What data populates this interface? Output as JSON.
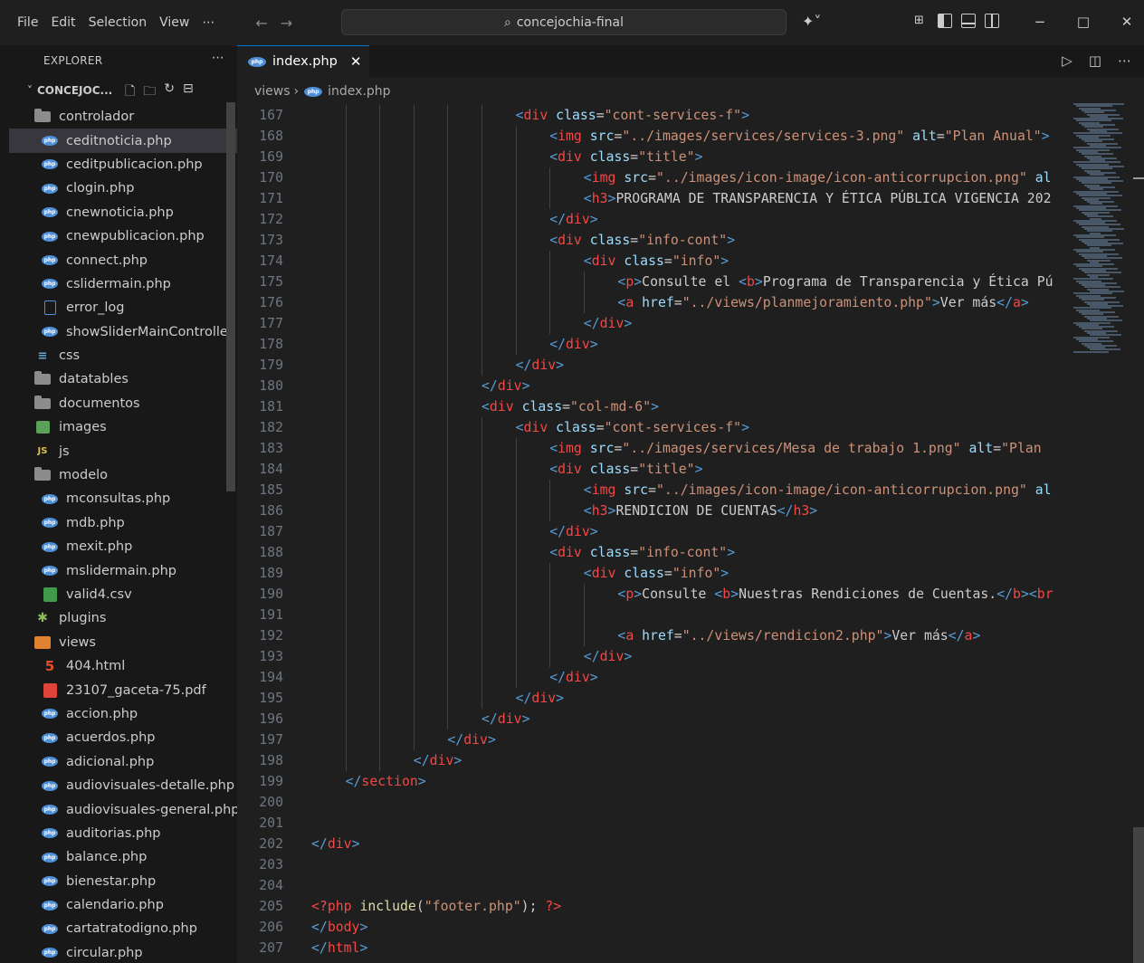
{
  "menu": [
    "File",
    "Edit",
    "Selection",
    "View",
    "⋯"
  ],
  "search": {
    "text": "concejochia-final"
  },
  "window": {
    "minimize": "−",
    "maximize": "□",
    "close": "✕"
  },
  "sidebar": {
    "title": "EXPLORER",
    "more": "⋯",
    "folder_name": "CONCEJOC...",
    "items": [
      {
        "label": "controlador",
        "icon": "folder-icon",
        "level": 1
      },
      {
        "label": "ceditnoticia.php",
        "icon": "php-icon",
        "level": 2,
        "active": true
      },
      {
        "label": "ceditpublicacion.php",
        "icon": "php-icon",
        "level": 2
      },
      {
        "label": "clogin.php",
        "icon": "php-icon",
        "level": 2
      },
      {
        "label": "cnewnoticia.php",
        "icon": "php-icon",
        "level": 2
      },
      {
        "label": "cnewpublicacion.php",
        "icon": "php-icon",
        "level": 2
      },
      {
        "label": "connect.php",
        "icon": "php-icon",
        "level": 2
      },
      {
        "label": "cslidermain.php",
        "icon": "php-icon",
        "level": 2
      },
      {
        "label": "error_log",
        "icon": "file-icon",
        "level": 2
      },
      {
        "label": "showSliderMainControlle...",
        "icon": "php-icon",
        "level": 2
      },
      {
        "label": "css",
        "icon": "css-folder-icon",
        "level": 1
      },
      {
        "label": "datatables",
        "icon": "folder-icon",
        "level": 1
      },
      {
        "label": "documentos",
        "icon": "folder-icon",
        "level": 1
      },
      {
        "label": "images",
        "icon": "images-folder-icon",
        "level": 1
      },
      {
        "label": "js",
        "icon": "js-folder-icon",
        "level": 1
      },
      {
        "label": "modelo",
        "icon": "folder-icon",
        "level": 1
      },
      {
        "label": "mconsultas.php",
        "icon": "php-icon",
        "level": 2
      },
      {
        "label": "mdb.php",
        "icon": "php-icon",
        "level": 2
      },
      {
        "label": "mexit.php",
        "icon": "php-icon",
        "level": 2
      },
      {
        "label": "mslidermain.php",
        "icon": "php-icon",
        "level": 2
      },
      {
        "label": "valid4.csv",
        "icon": "csv-icon",
        "level": 2
      },
      {
        "label": "plugins",
        "icon": "plugins-folder-icon",
        "level": 1
      },
      {
        "label": "views",
        "icon": "views-folder-icon",
        "level": 1
      },
      {
        "label": "404.html",
        "icon": "html-icon",
        "level": 2
      },
      {
        "label": "23107_gaceta-75.pdf",
        "icon": "pdf-icon",
        "level": 2
      },
      {
        "label": "accion.php",
        "icon": "php-icon",
        "level": 2
      },
      {
        "label": "acuerdos.php",
        "icon": "php-icon",
        "level": 2
      },
      {
        "label": "adicional.php",
        "icon": "php-icon",
        "level": 2
      },
      {
        "label": "audiovisuales-detalle.php",
        "icon": "php-icon",
        "level": 2
      },
      {
        "label": "audiovisuales-general.php",
        "icon": "php-icon",
        "level": 2
      },
      {
        "label": "auditorias.php",
        "icon": "php-icon",
        "level": 2
      },
      {
        "label": "balance.php",
        "icon": "php-icon",
        "level": 2
      },
      {
        "label": "bienestar.php",
        "icon": "php-icon",
        "level": 2
      },
      {
        "label": "calendario.php",
        "icon": "php-icon",
        "level": 2
      },
      {
        "label": "cartatratodigno.php",
        "icon": "php-icon",
        "level": 2
      },
      {
        "label": "circular.php",
        "icon": "php-icon",
        "level": 2
      }
    ]
  },
  "tab": {
    "label": "index.php",
    "close": "✕"
  },
  "breadcrumb": {
    "folder": "views",
    "sep": "›",
    "file": "index.php"
  },
  "editor": {
    "lines": [
      {
        "n": "167",
        "indent": 6,
        "tokens": [
          [
            "t",
            "<"
          ],
          [
            "tr",
            "div"
          ],
          [
            "an",
            " class"
          ],
          [
            "tg",
            "="
          ],
          [
            "av",
            "\"cont-services-f\""
          ],
          [
            "t",
            ">"
          ]
        ]
      },
      {
        "n": "168",
        "indent": 7,
        "tokens": [
          [
            "t",
            "<"
          ],
          [
            "tr",
            "img"
          ],
          [
            "an",
            " src"
          ],
          [
            "tg",
            "="
          ],
          [
            "av",
            "\"../images/services/services-3.png\""
          ],
          [
            "an",
            " alt"
          ],
          [
            "tg",
            "="
          ],
          [
            "av",
            "\"Plan Anual\""
          ],
          [
            "t",
            ">"
          ]
        ]
      },
      {
        "n": "169",
        "indent": 7,
        "tokens": [
          [
            "t",
            "<"
          ],
          [
            "tr",
            "div"
          ],
          [
            "an",
            " class"
          ],
          [
            "tg",
            "="
          ],
          [
            "av",
            "\"title\""
          ],
          [
            "t",
            ">"
          ]
        ]
      },
      {
        "n": "170",
        "indent": 8,
        "tokens": [
          [
            "t",
            "<"
          ],
          [
            "tr",
            "img"
          ],
          [
            "an",
            " src"
          ],
          [
            "tg",
            "="
          ],
          [
            "av",
            "\"../images/icon-image/icon-anticorrupcion.png\""
          ],
          [
            "an",
            " al"
          ]
        ]
      },
      {
        "n": "171",
        "indent": 8,
        "tokens": [
          [
            "t",
            "<"
          ],
          [
            "tr",
            "h3"
          ],
          [
            "t",
            ">"
          ],
          [
            "tg",
            "PROGRAMA DE TRANSPARENCIA Y ÉTICA PÚBLICA VIGENCIA 202"
          ]
        ]
      },
      {
        "n": "172",
        "indent": 7,
        "tokens": [
          [
            "t",
            "</"
          ],
          [
            "tr",
            "div"
          ],
          [
            "t",
            ">"
          ]
        ]
      },
      {
        "n": "173",
        "indent": 7,
        "tokens": [
          [
            "t",
            "<"
          ],
          [
            "tr",
            "div"
          ],
          [
            "an",
            " class"
          ],
          [
            "tg",
            "="
          ],
          [
            "av",
            "\"info-cont\""
          ],
          [
            "t",
            ">"
          ]
        ]
      },
      {
        "n": "174",
        "indent": 8,
        "tokens": [
          [
            "t",
            "<"
          ],
          [
            "tr",
            "div"
          ],
          [
            "an",
            " class"
          ],
          [
            "tg",
            "="
          ],
          [
            "av",
            "\"info\""
          ],
          [
            "t",
            ">"
          ]
        ]
      },
      {
        "n": "175",
        "indent": 9,
        "tokens": [
          [
            "t",
            "<"
          ],
          [
            "tr",
            "p"
          ],
          [
            "t",
            ">"
          ],
          [
            "tg",
            "Consulte el "
          ],
          [
            "t",
            "<"
          ],
          [
            "tr",
            "b"
          ],
          [
            "t",
            ">"
          ],
          [
            "tg",
            "Programa de Transparencia y Ética Pú"
          ]
        ]
      },
      {
        "n": "176",
        "indent": 9,
        "tokens": [
          [
            "t",
            "<"
          ],
          [
            "tr",
            "a"
          ],
          [
            "an",
            " href"
          ],
          [
            "tg",
            "="
          ],
          [
            "av",
            "\"../views/planmejoramiento.php\""
          ],
          [
            "t",
            ">"
          ],
          [
            "tg",
            "Ver más"
          ],
          [
            "t",
            "</"
          ],
          [
            "tr",
            "a"
          ],
          [
            "t",
            ">"
          ]
        ]
      },
      {
        "n": "177",
        "indent": 8,
        "tokens": [
          [
            "t",
            "</"
          ],
          [
            "tr",
            "div"
          ],
          [
            "t",
            ">"
          ]
        ]
      },
      {
        "n": "178",
        "indent": 7,
        "tokens": [
          [
            "t",
            "</"
          ],
          [
            "tr",
            "div"
          ],
          [
            "t",
            ">"
          ]
        ]
      },
      {
        "n": "179",
        "indent": 6,
        "tokens": [
          [
            "t",
            "</"
          ],
          [
            "tr",
            "div"
          ],
          [
            "t",
            ">"
          ]
        ]
      },
      {
        "n": "180",
        "indent": 5,
        "tokens": [
          [
            "t",
            "</"
          ],
          [
            "tr",
            "div"
          ],
          [
            "t",
            ">"
          ]
        ]
      },
      {
        "n": "181",
        "indent": 5,
        "tokens": [
          [
            "t",
            "<"
          ],
          [
            "tr",
            "div"
          ],
          [
            "an",
            " class"
          ],
          [
            "tg",
            "="
          ],
          [
            "av",
            "\"col-md-6\""
          ],
          [
            "t",
            ">"
          ]
        ]
      },
      {
        "n": "182",
        "indent": 6,
        "tokens": [
          [
            "t",
            "<"
          ],
          [
            "tr",
            "div"
          ],
          [
            "an",
            " class"
          ],
          [
            "tg",
            "="
          ],
          [
            "av",
            "\"cont-services-f\""
          ],
          [
            "t",
            ">"
          ]
        ]
      },
      {
        "n": "183",
        "indent": 7,
        "tokens": [
          [
            "t",
            "<"
          ],
          [
            "tr",
            "img"
          ],
          [
            "an",
            " src"
          ],
          [
            "tg",
            "="
          ],
          [
            "av",
            "\"../images/services/Mesa de trabajo 1.png\""
          ],
          [
            "an",
            " alt"
          ],
          [
            "tg",
            "="
          ],
          [
            "av",
            "\"Plan "
          ]
        ]
      },
      {
        "n": "184",
        "indent": 7,
        "tokens": [
          [
            "t",
            "<"
          ],
          [
            "tr",
            "div"
          ],
          [
            "an",
            " class"
          ],
          [
            "tg",
            "="
          ],
          [
            "av",
            "\"title\""
          ],
          [
            "t",
            ">"
          ]
        ]
      },
      {
        "n": "185",
        "indent": 8,
        "tokens": [
          [
            "t",
            "<"
          ],
          [
            "tr",
            "img"
          ],
          [
            "an",
            " src"
          ],
          [
            "tg",
            "="
          ],
          [
            "av",
            "\"../images/icon-image/icon-anticorrupcion.png\""
          ],
          [
            "an",
            " al"
          ]
        ]
      },
      {
        "n": "186",
        "indent": 8,
        "tokens": [
          [
            "t",
            "<"
          ],
          [
            "tr",
            "h3"
          ],
          [
            "t",
            ">"
          ],
          [
            "tg",
            "RENDICION DE CUENTAS"
          ],
          [
            "t",
            "</"
          ],
          [
            "tr",
            "h3"
          ],
          [
            "t",
            ">"
          ]
        ]
      },
      {
        "n": "187",
        "indent": 7,
        "tokens": [
          [
            "t",
            "</"
          ],
          [
            "tr",
            "div"
          ],
          [
            "t",
            ">"
          ]
        ]
      },
      {
        "n": "188",
        "indent": 7,
        "tokens": [
          [
            "t",
            "<"
          ],
          [
            "tr",
            "div"
          ],
          [
            "an",
            " class"
          ],
          [
            "tg",
            "="
          ],
          [
            "av",
            "\"info-cont\""
          ],
          [
            "t",
            ">"
          ]
        ]
      },
      {
        "n": "189",
        "indent": 8,
        "tokens": [
          [
            "t",
            "<"
          ],
          [
            "tr",
            "div"
          ],
          [
            "an",
            " class"
          ],
          [
            "tg",
            "="
          ],
          [
            "av",
            "\"info\""
          ],
          [
            "t",
            ">"
          ]
        ]
      },
      {
        "n": "190",
        "indent": 9,
        "tokens": [
          [
            "t",
            "<"
          ],
          [
            "tr",
            "p"
          ],
          [
            "t",
            ">"
          ],
          [
            "tg",
            "Consulte "
          ],
          [
            "t",
            "<"
          ],
          [
            "tr",
            "b"
          ],
          [
            "t",
            ">"
          ],
          [
            "tg",
            "Nuestras Rendiciones de Cuentas."
          ],
          [
            "t",
            "</"
          ],
          [
            "tr",
            "b"
          ],
          [
            "t",
            ">"
          ],
          [
            "t",
            "<"
          ],
          [
            "tr",
            "br"
          ]
        ]
      },
      {
        "n": "191",
        "indent": 9,
        "tokens": []
      },
      {
        "n": "192",
        "indent": 9,
        "tokens": [
          [
            "t",
            "<"
          ],
          [
            "tr",
            "a"
          ],
          [
            "an",
            " href"
          ],
          [
            "tg",
            "="
          ],
          [
            "av",
            "\"../views/rendicion2.php\""
          ],
          [
            "t",
            ">"
          ],
          [
            "tg",
            "Ver más"
          ],
          [
            "t",
            "</"
          ],
          [
            "tr",
            "a"
          ],
          [
            "t",
            ">"
          ]
        ]
      },
      {
        "n": "193",
        "indent": 8,
        "tokens": [
          [
            "t",
            "</"
          ],
          [
            "tr",
            "div"
          ],
          [
            "t",
            ">"
          ]
        ]
      },
      {
        "n": "194",
        "indent": 7,
        "tokens": [
          [
            "t",
            "</"
          ],
          [
            "tr",
            "div"
          ],
          [
            "t",
            ">"
          ]
        ]
      },
      {
        "n": "195",
        "indent": 6,
        "tokens": [
          [
            "t",
            "</"
          ],
          [
            "tr",
            "div"
          ],
          [
            "t",
            ">"
          ]
        ]
      },
      {
        "n": "196",
        "indent": 5,
        "tokens": [
          [
            "t",
            "</"
          ],
          [
            "tr",
            "div"
          ],
          [
            "t",
            ">"
          ]
        ]
      },
      {
        "n": "197",
        "indent": 4,
        "tokens": [
          [
            "t",
            "</"
          ],
          [
            "tr",
            "div"
          ],
          [
            "t",
            ">"
          ]
        ]
      },
      {
        "n": "198",
        "indent": 3,
        "tokens": [
          [
            "t",
            "</"
          ],
          [
            "tr",
            "div"
          ],
          [
            "t",
            ">"
          ]
        ]
      },
      {
        "n": "199",
        "indent": 1,
        "tokens": [
          [
            "t",
            "</"
          ],
          [
            "tr",
            "section"
          ],
          [
            "t",
            ">"
          ]
        ]
      },
      {
        "n": "200",
        "indent": 0,
        "tokens": []
      },
      {
        "n": "201",
        "indent": 0,
        "tokens": []
      },
      {
        "n": "202",
        "indent": 0,
        "tokens": [
          [
            "t",
            "</"
          ],
          [
            "tr",
            "div"
          ],
          [
            "t",
            ">"
          ]
        ]
      },
      {
        "n": "203",
        "indent": 0,
        "tokens": []
      },
      {
        "n": "204",
        "indent": 0,
        "tokens": []
      },
      {
        "n": "205",
        "indent": 0,
        "tokens": [
          [
            "ph",
            "<?php"
          ],
          [
            "fn",
            " include"
          ],
          [
            "tg",
            "("
          ],
          [
            "av",
            "\"footer.php\""
          ],
          [
            "tg",
            "); "
          ],
          [
            "ph",
            "?>"
          ]
        ]
      },
      {
        "n": "206",
        "indent": 0,
        "tokens": [
          [
            "t",
            "</"
          ],
          [
            "tr",
            "body"
          ],
          [
            "t",
            ">"
          ]
        ]
      },
      {
        "n": "207",
        "indent": 0,
        "tokens": [
          [
            "t",
            "</"
          ],
          [
            "tr",
            "html"
          ],
          [
            "t",
            ">"
          ]
        ]
      }
    ]
  }
}
